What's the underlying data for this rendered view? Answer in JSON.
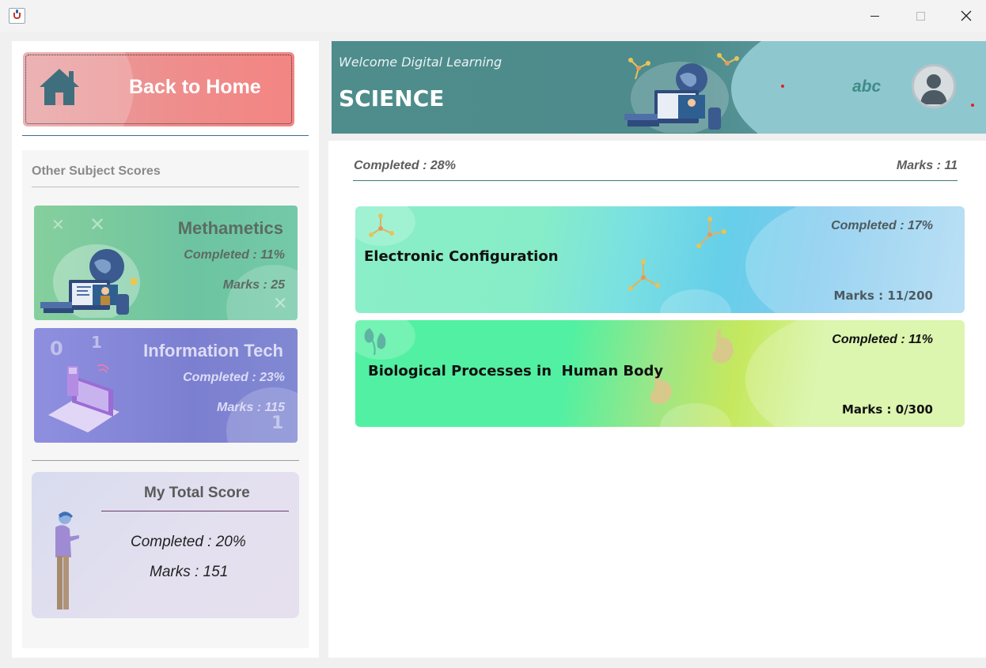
{
  "window": {
    "minimize_label": "Minimize",
    "maximize_label": "Maximize",
    "close_label": "Close"
  },
  "sidebar": {
    "home_button_label": "Back to Home",
    "other_scores_title": "Other Subject Scores",
    "subjects": [
      {
        "name": "Methametics",
        "completed": "Completed : 11%",
        "marks": "Marks : 25"
      },
      {
        "name": "Information Tech",
        "completed": "Completed : 23%",
        "marks": "Marks : 115"
      }
    ],
    "total": {
      "title": "My Total Score",
      "completed": "Completed : 20%",
      "marks": "Marks : 151"
    }
  },
  "header": {
    "welcome": "Welcome Digital Learning",
    "subject": "SCIENCE",
    "decor_text": "abc"
  },
  "main": {
    "summary_completed": "Completed : 28%",
    "summary_marks": "Marks : 11",
    "topics": [
      {
        "title": "Electronic Configuration",
        "completed": "Completed : 17%",
        "marks": "Marks : 11/200"
      },
      {
        "title": "Biological Processes in  Human Body",
        "completed": "Completed : 11%",
        "marks": "Marks : 0/300"
      }
    ]
  },
  "colors": {
    "home_button": "#ee8e8d",
    "math_card": "#6dc4a0",
    "it_card": "#7c7fd0",
    "header": "#4f8c8c",
    "topic_1": "#7ae0e2",
    "topic_2": "#52f0a2"
  }
}
